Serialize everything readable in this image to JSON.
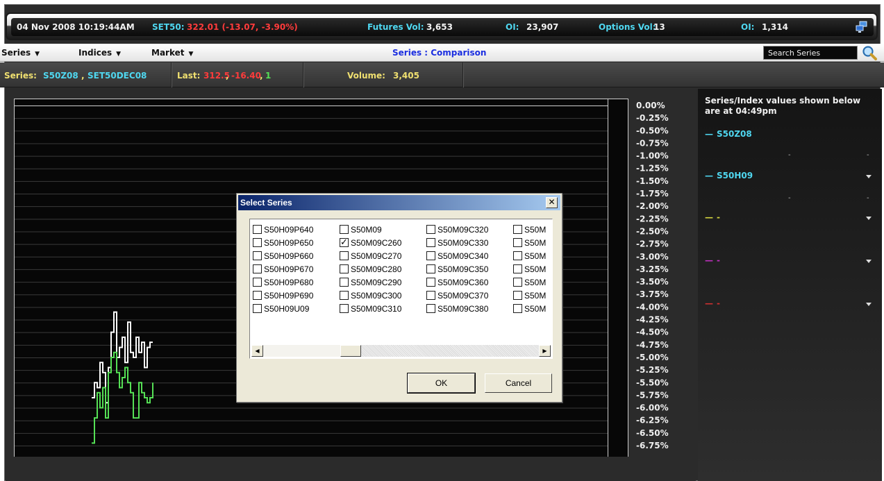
{
  "ticker": {
    "datetime": "04 Nov 2008 10:19:44AM",
    "index_label": "SET50:",
    "index_value": "322.01 (-13.07, -3.90%)",
    "futures_vol_label": "Futures Vol:",
    "futures_vol_value": "3,653",
    "futures_oi_label": "OI:",
    "futures_oi_value": "23,907",
    "options_vol_label": "Options Vol:",
    "options_vol_value": "13",
    "options_oi_label": "OI:",
    "options_oi_value": "1,314",
    "icon": "network-icon"
  },
  "menubar": {
    "items": [
      {
        "label": "Series"
      },
      {
        "label": "Indices"
      },
      {
        "label": "Market"
      }
    ],
    "title": "Series : Comparison",
    "search_placeholder": "Search Series",
    "search_icon": "magnifier-icon"
  },
  "infobar": {
    "series_label": "Series:",
    "series_a": "S50Z08",
    "series_sep": ",",
    "series_b": "SET50DEC08",
    "last_label": "Last:",
    "last_price": "312.5",
    "last_change": "-16.40",
    "last_qty": "1",
    "volume_label": "Volume:",
    "volume_value": "3,405"
  },
  "chart": {
    "y_ticks": [
      "0.00%",
      "-0.25%",
      "-0.50%",
      "-0.75%",
      "-1.00%",
      "-1.25%",
      "-1.50%",
      "-1.75%",
      "-2.00%",
      "-2.25%",
      "-2.50%",
      "-2.75%",
      "-3.00%",
      "-3.25%",
      "-3.50%",
      "-3.75%",
      "-4.00%",
      "-4.25%",
      "-4.50%",
      "-4.75%",
      "-5.00%",
      "-5.25%",
      "-5.50%",
      "-5.75%",
      "-6.00%",
      "-6.25%",
      "-6.50%",
      "-6.75%"
    ],
    "colors": {
      "series1": "#ffffff",
      "series2": "#55e055",
      "grid": "#3a3a3a",
      "frame": "#d0d0d0",
      "bg": "#070707"
    }
  },
  "chart_data": {
    "type": "line",
    "ylim": [
      -6.75,
      0.0
    ],
    "series": [
      {
        "name": "S50Z08",
        "values": [
          -5.8,
          -5.5,
          -5.6,
          -5.1,
          -5.3,
          -5.9,
          -5.2,
          -4.5,
          -4.1,
          -5.0,
          -4.8,
          -4.6,
          -5.1,
          -4.3,
          -4.9,
          -5.0,
          -4.6,
          -4.9,
          -4.7,
          -5.2,
          -4.8,
          -4.7,
          -4.7
        ]
      },
      {
        "name": "S50H09",
        "values": [
          -6.7,
          -6.2,
          -5.7,
          -6.0,
          -5.6,
          -6.2,
          -5.3,
          -5.0,
          -4.9,
          -5.3,
          -5.6,
          -5.4,
          -5.2,
          -5.5,
          -5.7,
          -6.2,
          -6.2,
          -5.5,
          -5.7,
          -5.8,
          -5.9,
          -5.8,
          -5.5
        ]
      }
    ]
  },
  "rpanel": {
    "header": "Series/Index values shown below are at 04:49pm",
    "rows": [
      {
        "label": "S50Z08",
        "color": "#4fd7f0",
        "marker": "—"
      },
      {
        "label": "S50H09",
        "color": "#4fd7f0",
        "marker": "—"
      },
      {
        "label": "-",
        "color": "#d6d640",
        "marker": "—"
      },
      {
        "label": "-",
        "color": "#c030c0",
        "marker": "—"
      },
      {
        "label": "-",
        "color": "#d03030",
        "marker": "—"
      }
    ],
    "value_placeholder": "-"
  },
  "dialog": {
    "title": "Select Series",
    "close_glyph": "✕",
    "columns": [
      [
        "S50H09P640",
        "S50H09P650",
        "S50H09P660",
        "S50H09P670",
        "S50H09P680",
        "S50H09P690",
        "S50H09U09"
      ],
      [
        "S50M09",
        "S50M09C260",
        "S50M09C270",
        "S50M09C280",
        "S50M09C290",
        "S50M09C300",
        "S50M09C310"
      ],
      [
        "S50M09C320",
        "S50M09C330",
        "S50M09C340",
        "S50M09C350",
        "S50M09C360",
        "S50M09C370",
        "S50M09C380"
      ],
      [
        "S50M",
        "S50M",
        "S50M",
        "S50M",
        "S50M",
        "S50M",
        "S50M"
      ]
    ],
    "checked": [
      "S50M09C260"
    ],
    "ok_label": "OK",
    "cancel_label": "Cancel"
  }
}
